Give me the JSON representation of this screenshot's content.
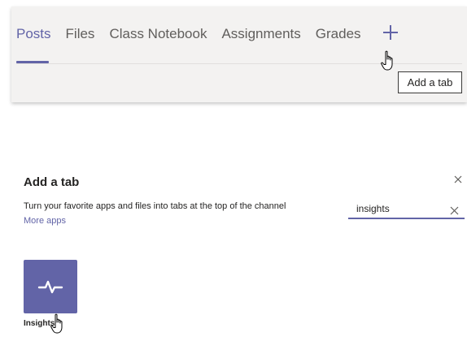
{
  "tabbar": {
    "tabs": [
      {
        "label": "Posts",
        "active": true
      },
      {
        "label": "Files",
        "active": false
      },
      {
        "label": "Class Notebook",
        "active": false
      },
      {
        "label": "Assignments",
        "active": false
      },
      {
        "label": "Grades",
        "active": false
      }
    ],
    "add_icon": "plus-icon",
    "tooltip": "Add a tab"
  },
  "dialog": {
    "title": "Add a tab",
    "description": "Turn your favorite apps and files into tabs at the top of the channel",
    "more_apps_link": "More apps",
    "search": {
      "value": "insights",
      "clear_icon": "close-icon"
    },
    "close_icon": "close-icon",
    "results": [
      {
        "label": "Insights",
        "icon": "pulse-icon"
      }
    ]
  },
  "colors": {
    "accent": "#6264a7",
    "panel_bg": "#f3f2f1",
    "text": "#252423",
    "muted_text": "#605e5c"
  },
  "cursor": "hand-pointer-icon"
}
